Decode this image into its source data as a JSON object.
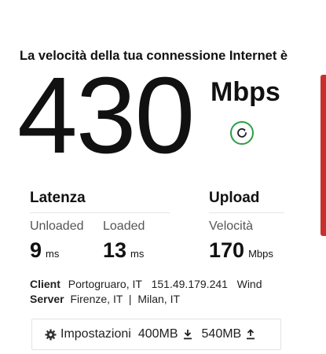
{
  "result": {
    "title": "La velocità della tua connessione Internet è",
    "speed": "430",
    "unit": "Mbps"
  },
  "latency": {
    "heading": "Latenza",
    "unloaded_label": "Unloaded",
    "unloaded_value": "9",
    "unloaded_unit": "ms",
    "loaded_label": "Loaded",
    "loaded_value": "13",
    "loaded_unit": "ms"
  },
  "upload": {
    "heading": "Upload",
    "speed_label": "Velocità",
    "value": "170",
    "unit": "Mbps"
  },
  "client": {
    "label": "Client",
    "location": "Portogruaro, IT",
    "ip": "151.49.179.241",
    "isp": "Wind"
  },
  "server": {
    "label": "Server",
    "locations": "Firenze, IT  |  Milan, IT"
  },
  "settings_bar": {
    "label": "Impostazioni",
    "download_size": "400MB",
    "upload_size": "540MB"
  },
  "icons": {
    "refresh": "refresh-icon",
    "gear": "gear-icon",
    "download": "download-icon",
    "upload": "upload-icon"
  },
  "colors": {
    "accent_green": "#2e9e44",
    "edge_red": "#c9302c"
  }
}
